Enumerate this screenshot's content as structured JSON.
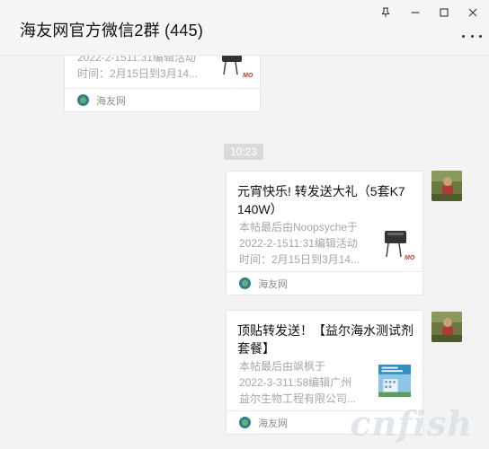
{
  "window": {
    "title": "海友网官方微信2群 (445)"
  },
  "chat": {
    "timestamp": "10:23",
    "messages": [
      {
        "desc": [
          "2022-2-1511:31编辑活动",
          "时间：2月15日到3月14..."
        ],
        "source": "海友网"
      },
      {
        "title": "元宵快乐! 转发送大礼（5套K7 140W）",
        "desc": [
          "本帖最后由Noopsyche于",
          "2022-2-1511:31编辑活动",
          "时间：2月15日到3月14..."
        ],
        "source": "海友网"
      },
      {
        "title": "顶贴转发送！【益尔海水测试剂套餐】",
        "desc": [
          "本帖最后由飒枫于",
          "2022-3-311:58编辑广州",
          "益尔生物工程有限公司..."
        ],
        "source": "海友网"
      }
    ]
  },
  "watermark": "cnfish"
}
